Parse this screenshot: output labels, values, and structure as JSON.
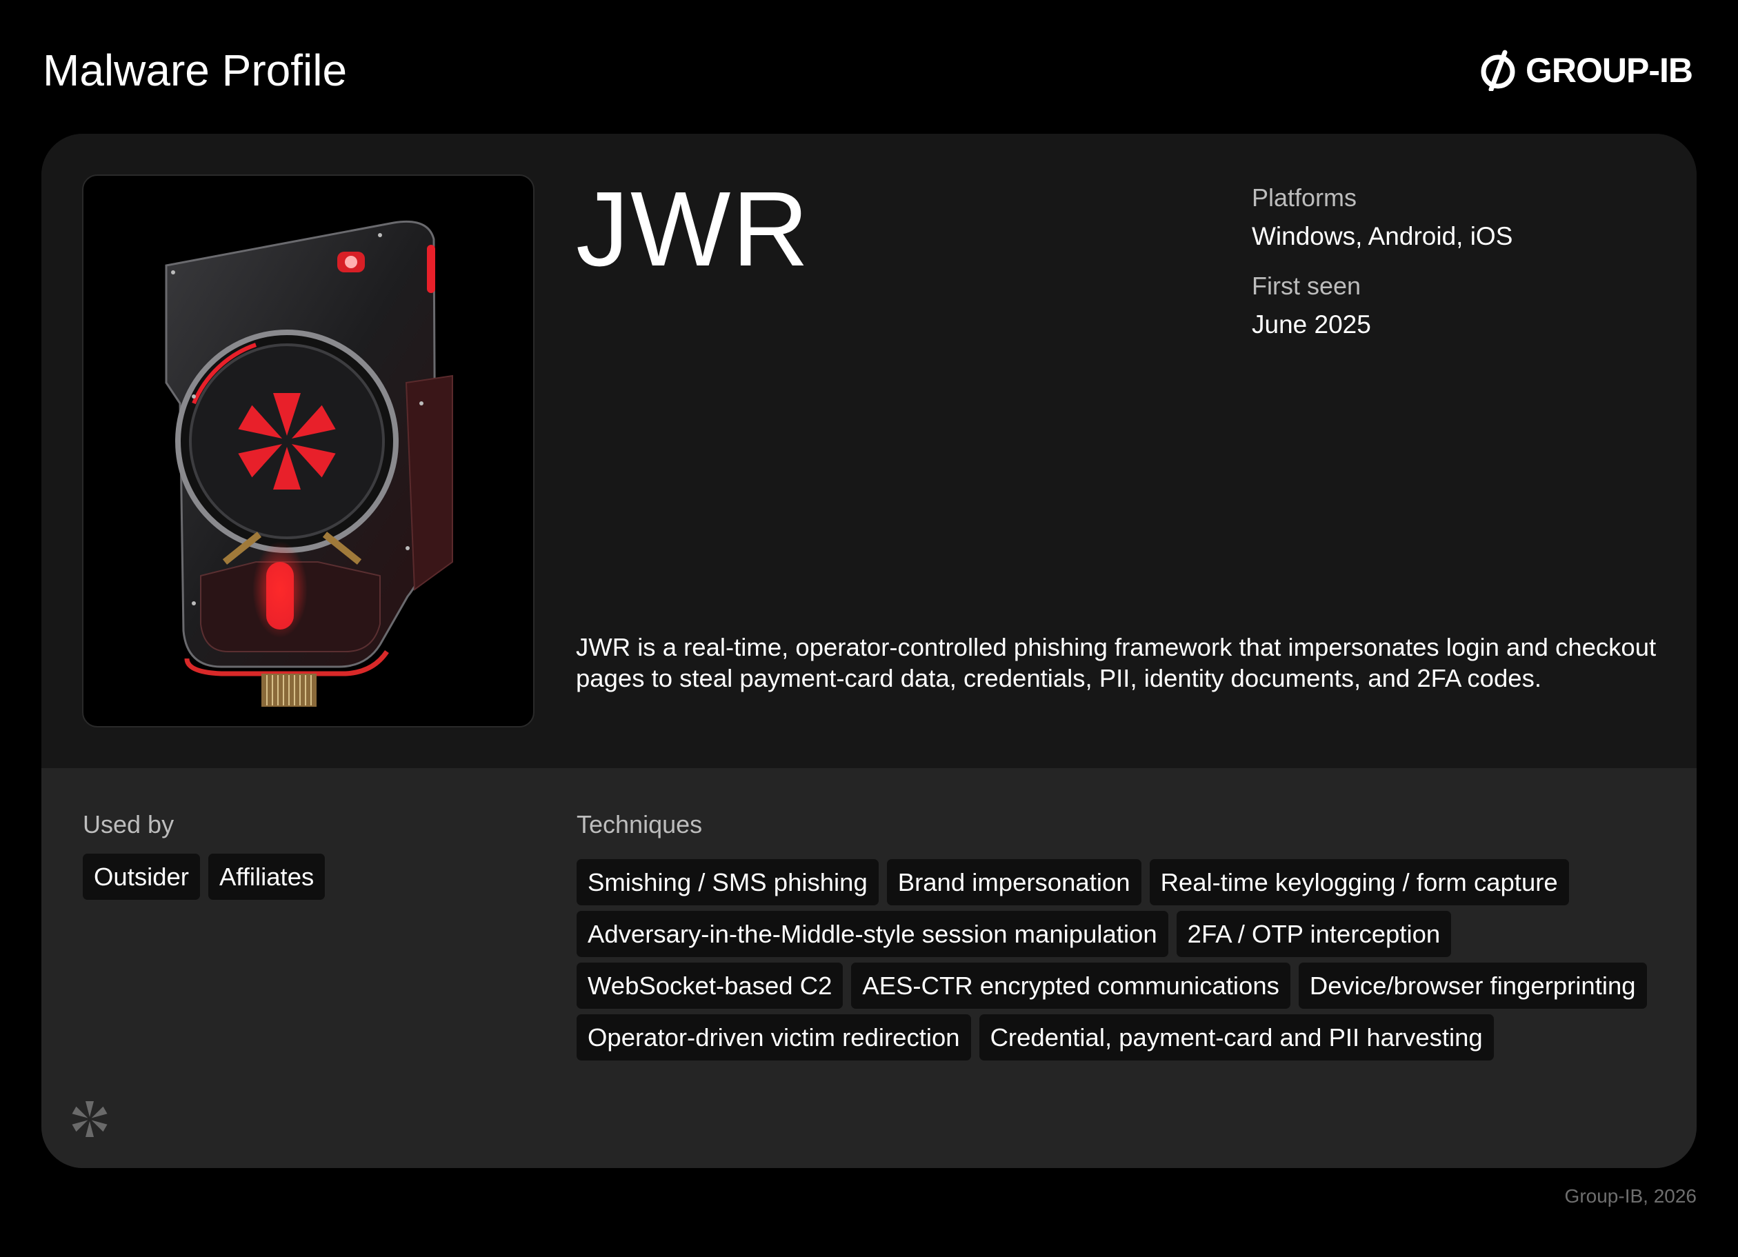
{
  "header": {
    "title": "Malware Profile",
    "brand": "GROUP-IB"
  },
  "profile": {
    "name": "JWR",
    "image_icon": "malware-device-illustration",
    "platforms_label": "Platforms",
    "platforms_value": "Windows, Android, iOS",
    "first_seen_label": "First seen",
    "first_seen_value": "June 2025",
    "description": "JWR is a real-time, operator-controlled phishing framework that impersonates login and checkout pages to steal payment-card data, credentials, PII, identity documents, and 2FA codes."
  },
  "used_by": {
    "label": "Used by",
    "items": [
      "Outsider",
      "Affiliates"
    ]
  },
  "techniques": {
    "label": "Techniques",
    "items": [
      "Smishing / SMS phishing",
      "Brand impersonation",
      "Real-time keylogging / form capture",
      "Adversary-in-the-Middle-style session manipulation",
      "2FA / OTP interception",
      "WebSocket-based C2",
      "AES-CTR encrypted communications",
      "Device/browser fingerprinting",
      "Operator-driven victim redirection",
      "Credential, payment-card and PII harvesting"
    ]
  },
  "footer": {
    "text": "Group-IB, 2026"
  },
  "colors": {
    "background": "#000000",
    "card_top": "#171717",
    "card_bottom": "#252525",
    "chip": "#0f0f0f",
    "accent_red": "#e8202a",
    "muted_text": "#bdbdbd"
  }
}
